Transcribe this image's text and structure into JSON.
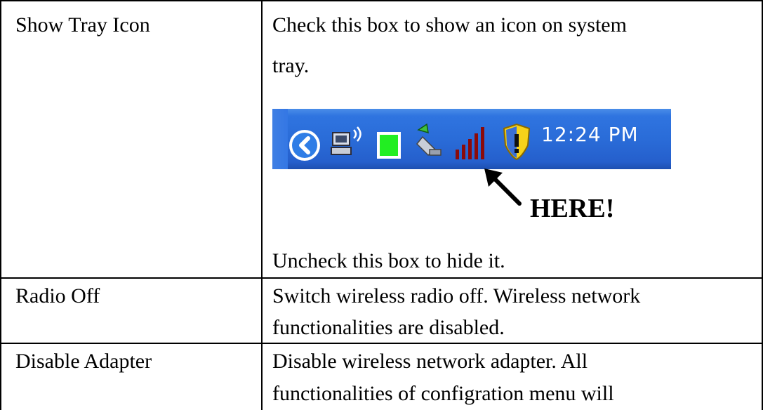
{
  "rows": [
    {
      "setting": "Show Tray Icon",
      "description_lines": [
        "Check this box to show an icon on system",
        "tray."
      ],
      "after_image_text": "Uncheck this box to hide it."
    },
    {
      "setting": "Radio Off",
      "description_lines": [
        "Switch wireless radio off. Wireless network",
        "functionalities are disabled."
      ]
    },
    {
      "setting": "Disable Adapter",
      "description_lines": [
        "Disable wireless network adapter. All",
        "functionalities of configration menu will"
      ]
    }
  ],
  "tray": {
    "clock": "12:24 PM",
    "icons": [
      "back-chevron-icon",
      "wireless-computer-icon",
      "green-square-icon",
      "network-plug-icon",
      "signal-bars-icon",
      "security-shield-icon"
    ],
    "colors": {
      "taskbar": "#2a6cd8",
      "signal": "#8b0a0a",
      "green": "#22ee22"
    }
  },
  "callout": {
    "label": "HERE!"
  }
}
